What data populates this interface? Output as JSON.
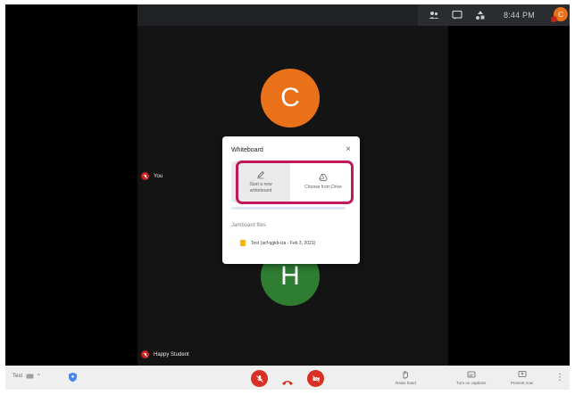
{
  "top_bar": {
    "time": "8:44 PM",
    "avatar_initial": "C",
    "icons": [
      "people-icon",
      "chat-icon",
      "activities-icon"
    ]
  },
  "tiles": {
    "top_avatar_letter": "C",
    "bottom_avatar_letter": "H",
    "self_label": "You",
    "other_label": "Happy Student"
  },
  "dialog": {
    "title": "Whiteboard",
    "close": "×",
    "option_new": "Start a new whiteboard",
    "option_drive": "Choose from Drive",
    "files_heading": "Jamboard files",
    "file_name": "Test (acf-qgkb-iza - Feb 3, 2021)"
  },
  "bottom_bar": {
    "meeting_name": "Test",
    "raise_hand": "Raise hand",
    "captions": "Turn on captions",
    "present": "Present now",
    "more": "⋮"
  },
  "colors": {
    "accent_orange": "#e8711a",
    "accent_green": "#2e7d32",
    "danger_red": "#d93025",
    "highlight": "#c2185b"
  }
}
